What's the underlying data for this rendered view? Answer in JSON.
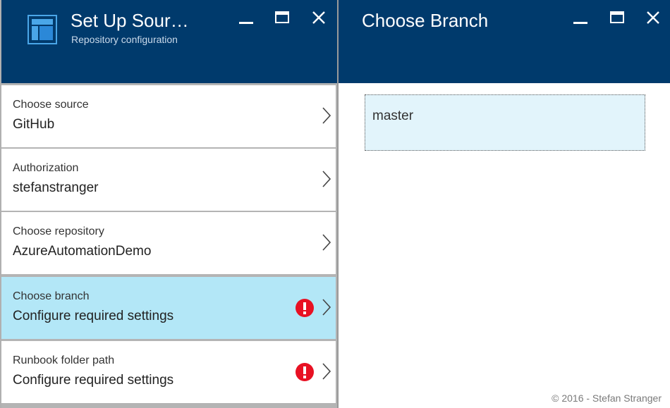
{
  "left_blade": {
    "title": "Set Up Sour…",
    "subtitle": "Repository configuration",
    "rows": [
      {
        "label": "Choose source",
        "value": "GitHub",
        "warning": false
      },
      {
        "label": "Authorization",
        "value": "stefanstranger",
        "warning": false
      },
      {
        "label": "Choose repository",
        "value": "AzureAutomationDemo",
        "warning": false
      },
      {
        "label": "Choose branch",
        "value": "Configure required settings",
        "warning": true,
        "selected": true
      },
      {
        "label": "Runbook folder path",
        "value": "Configure required settings",
        "warning": true
      }
    ]
  },
  "right_blade": {
    "title": "Choose Branch",
    "branches": [
      "master"
    ]
  },
  "footer": {
    "copyright": "© 2016 - Stefan Stranger"
  },
  "colors": {
    "header_bg": "#003a6c",
    "selected_row": "#b3e7f7",
    "warning": "#e81123",
    "branch_item_bg": "#e2f4fb"
  },
  "icons": {
    "blade_logo": "source-control-icon",
    "minimize": "minimize-icon",
    "maximize": "maximize-icon",
    "close": "close-icon",
    "row_chevron": "chevron-right-icon",
    "row_warning": "error-exclamation-icon"
  }
}
